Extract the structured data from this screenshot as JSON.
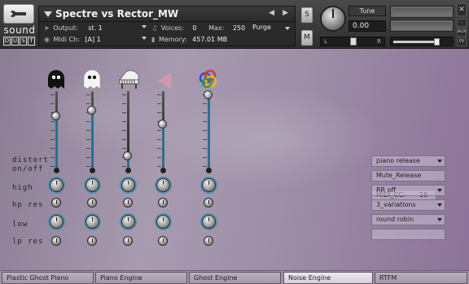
{
  "header": {
    "logo_top": "sound",
    "logo_bottom_letters": [
      "D",
      "U",
      "S",
      "T"
    ],
    "instrument_title": "Spectre vs Rector_MW",
    "output_label": "Output:",
    "output_value": "st. 1",
    "midi_label": "Midi Ch:",
    "midi_value": "[A] 1",
    "voices_label": "Voices:",
    "voices_value": "0",
    "max_label": "Max:",
    "max_value": "250",
    "purge_label": "Purge",
    "memory_label": "Memory:",
    "memory_value": "457.01 MB",
    "solo_label": "S",
    "mute_label": "M",
    "tune_label": "Tune",
    "tune_value": "0.00",
    "pan_left": "L",
    "pan_right": "R",
    "side_aux": "AUX",
    "side_pv": "PV"
  },
  "main": {
    "columns": [
      {
        "icon": "black-ghost-icon",
        "slider_level": 0.68
      },
      {
        "icon": "white-ghost-icon",
        "slider_level": 0.76
      },
      {
        "icon": "grand-piano-icon",
        "slider_level": 0.18
      },
      {
        "icon": "pink-triangle-icon",
        "slider_level": 0.58
      },
      {
        "icon": "colored-rings-icon",
        "slider_level": 0.95
      }
    ],
    "row_labels": {
      "distort": "distort",
      "onoff": "on/off",
      "high": "high",
      "hp_res": "hp res",
      "low": "low",
      "lp_res": "lp res"
    },
    "right_panel": {
      "midi_cc_label": "MIDI_CC:",
      "midi_cc_value": "16",
      "menu1": "piano release",
      "field2": "Mute_Release",
      "menu3": "RR off",
      "menu4": "3_variations",
      "menu5": "round robin"
    }
  },
  "tabs": [
    "Plastic Ghost Piano",
    "Piano Engine",
    "Ghost Engine",
    "Noise Engine",
    "RTFM"
  ],
  "active_tab": "Noise Engine",
  "colors": {
    "accent_ring": "#4b91ad",
    "slider_fill": "#2c6f8a",
    "background_purple": "#9e8fa7"
  }
}
